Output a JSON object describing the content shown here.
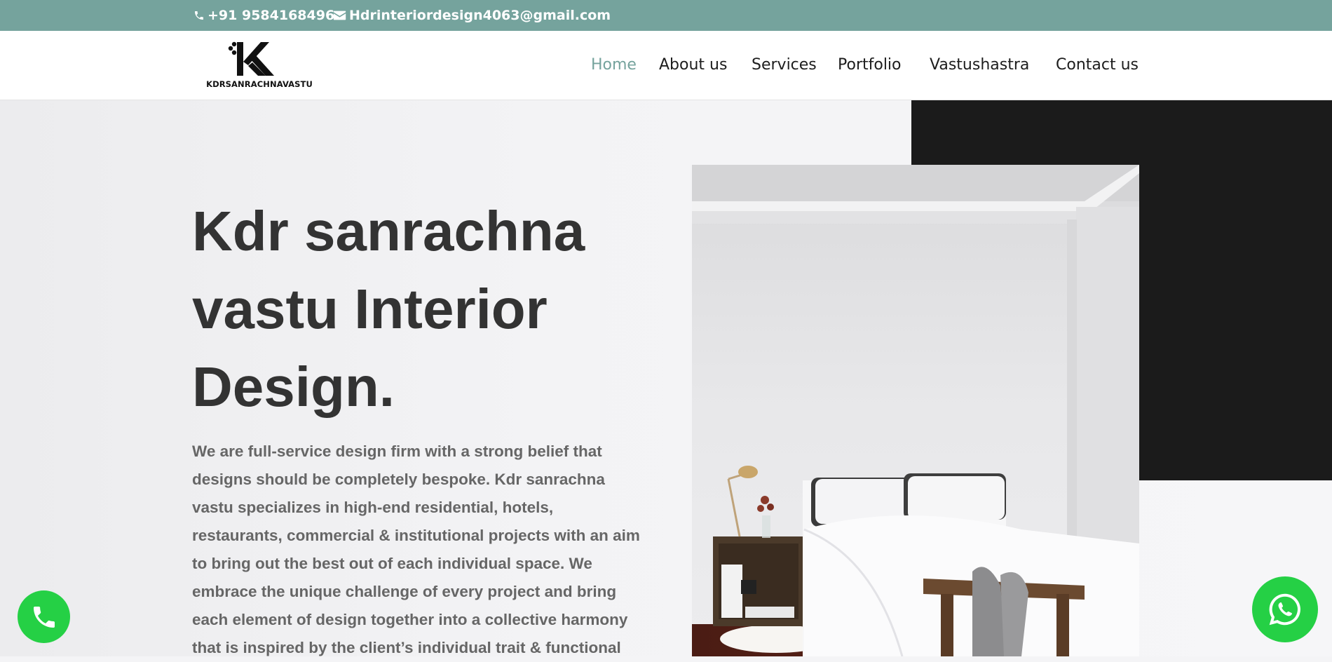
{
  "topbar": {
    "phone": "+91 9584168496",
    "email": "Hdrinteriordesign4063@gmail.com",
    "phone_icon": "phone-icon",
    "email_icon": "envelope-icon"
  },
  "header": {
    "logo_text": "KDRSANRACHNAVASTU",
    "nav": [
      {
        "label": "Home",
        "active": true
      },
      {
        "label": "About us"
      },
      {
        "label": "Services"
      },
      {
        "label": "Portfolio"
      },
      {
        "label": "Vastushastra"
      },
      {
        "label": "Contact us"
      }
    ]
  },
  "hero": {
    "headline": "Kdr sanrachna vastu Interior Design.",
    "body": "We are full-service design firm with a strong belief that designs should be completely bespoke. Kdr sanrachna vastu specializes in high-end residential, hotels, restaurants, commercial & institutional projects with an aim to bring out the best out of each individual space. We embrace the unique challenge of every project and bring each element of design together into a collective harmony that is inspired by the client’s individual trait & functional"
  },
  "floating": {
    "call_icon": "phone-icon",
    "whatsapp_icon": "whatsapp-icon"
  },
  "colors": {
    "accent": "#75a39d",
    "dark_block": "#1b1b1b",
    "fab_green": "#25d045",
    "heading": "#333333",
    "body_text": "#666666"
  }
}
